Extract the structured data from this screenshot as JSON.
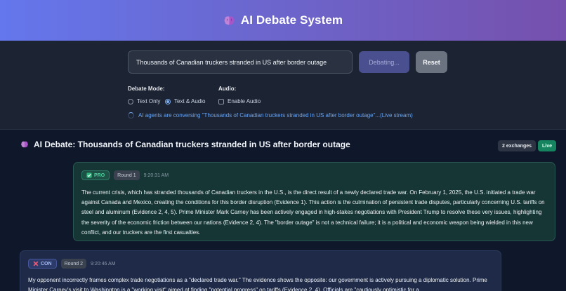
{
  "header": {
    "title": "AI Debate System",
    "icon": "brain-icon"
  },
  "controls": {
    "topic_value": "Thousands of Canadian truckers stranded in US after border outage",
    "debating_label": "Debating...",
    "reset_label": "Reset",
    "debate_mode_label": "Debate Mode:",
    "modes": [
      {
        "label": "Text Only",
        "selected": false
      },
      {
        "label": "Text & Audio",
        "selected": true
      }
    ],
    "audio_label": "Audio:",
    "enable_audio_label": "Enable Audio",
    "enable_audio_checked": false,
    "status_text": "AI agents are conversing \"Thousands of Canadian truckers stranded in US after border outage\"...(Live stream)"
  },
  "debate": {
    "title": "AI Debate: Thousands of Canadian truckers stranded in US after border outage",
    "exchanges_badge": "2 exchanges",
    "live_badge": "Live",
    "messages": [
      {
        "side": "PRO",
        "round": "Round 1",
        "time": "9:20:31 AM",
        "text": "The current crisis, which has stranded thousands of Canadian truckers in the U.S., is the direct result of a newly declared trade war. On February 1, 2025, the U.S. initiated a trade war against Canada and Mexico, creating the conditions for this border disruption (Evidence 1). This action is the culmination of persistent trade disputes, particularly concerning U.S. tariffs on steel and aluminum (Evidence 2, 4, 5). Prime Minister Mark Carney has been actively engaged in high-stakes negotiations with President Trump to resolve these very issues, highlighting the severity of the economic friction between our nations (Evidence 2, 4). The \"border outage\" is not a technical failure; it is a political and economic weapon being wielded in this new conflict, and our truckers are the first casualties."
      },
      {
        "side": "CON",
        "round": "Round 2",
        "time": "9:20:46 AM",
        "text": "My opponent incorrectly frames complex trade negotiations as a \"declared trade war.\" The evidence shows the opposite: our government is actively pursuing a diplomatic solution. Prime Minister Carney's visit to Washington is a \"working visit\" aimed at finding \"potential progress\" on tariffs (Evidence 2, 4). Officials are \"cautiously optimistic for a"
      }
    ]
  },
  "colors": {
    "header_gradient_start": "#6477ec",
    "header_gradient_end": "#7650ad",
    "pro_accent": "#4dd19e",
    "con_accent": "#a6bbf6",
    "live_badge": "#16845f"
  }
}
